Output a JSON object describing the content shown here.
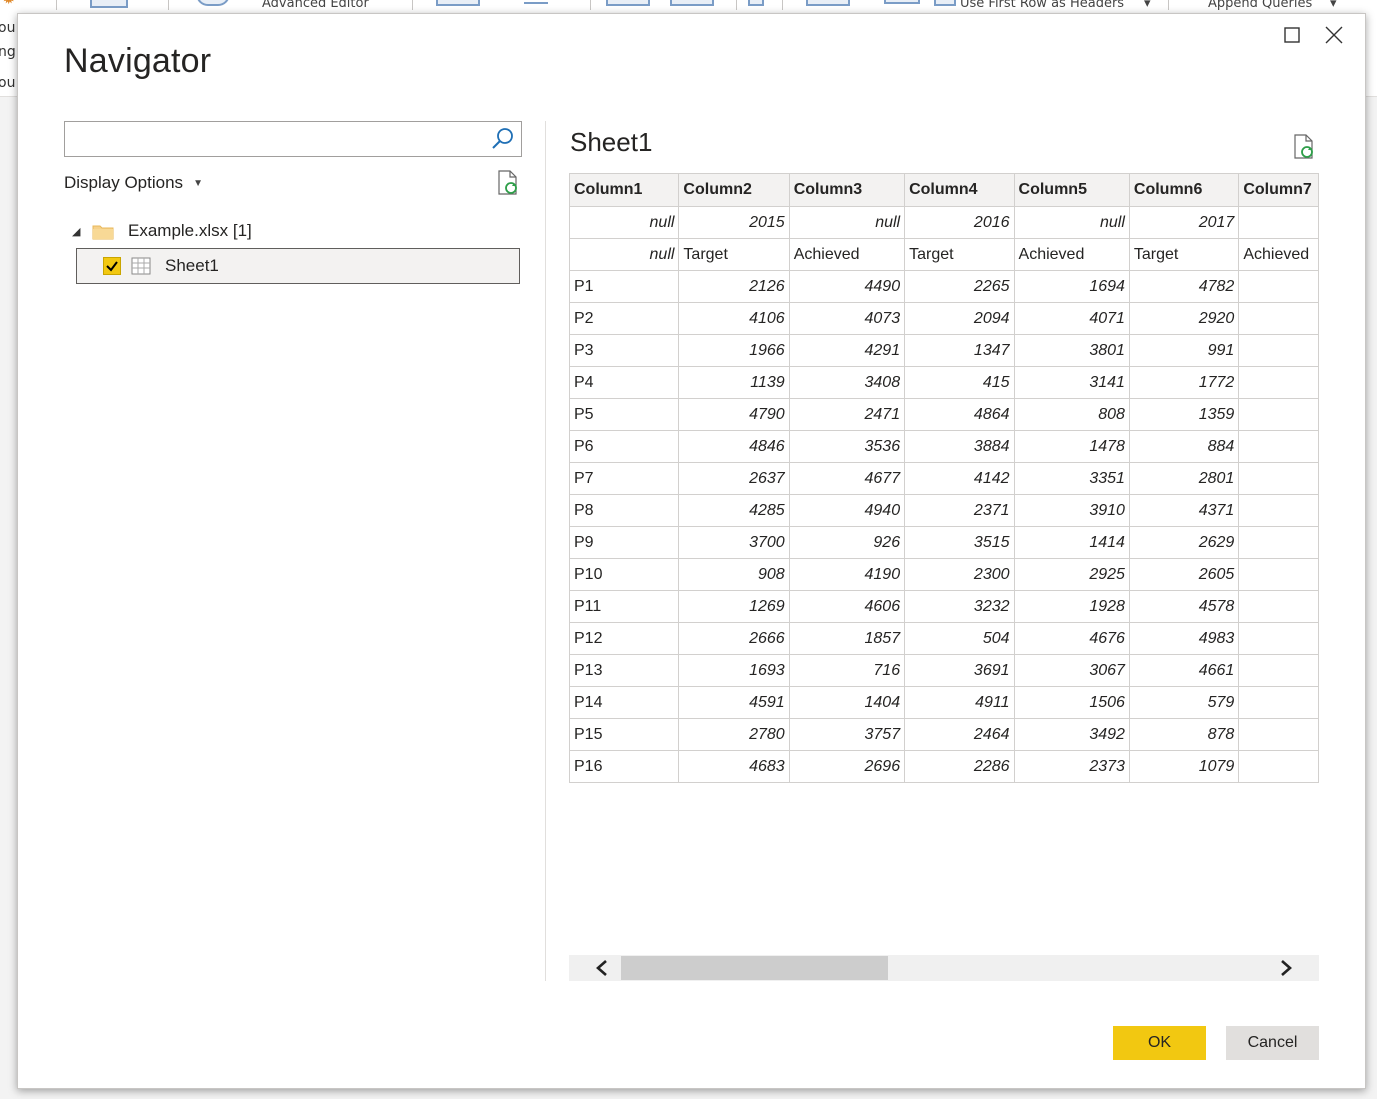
{
  "ribbon": {
    "advanced_editor": "Advanced Editor",
    "use_first_row": "Use First Row as Headers",
    "append_queries": "Append Queries",
    "left_fragments": [
      "ou",
      "ng",
      "ou"
    ]
  },
  "dialog": {
    "title": "Navigator",
    "search": {
      "value": "",
      "placeholder": ""
    },
    "display_options": "Display Options",
    "tree": {
      "file_label": "Example.xlsx [1]",
      "sheet_label": "Sheet1",
      "sheet_checked": true
    },
    "preview": {
      "title": "Sheet1",
      "columns": [
        "Column1",
        "Column2",
        "Column3",
        "Column4",
        "Column5",
        "Column6",
        "Column7"
      ],
      "rows": [
        [
          "",
          "null",
          "2015",
          "null",
          "2016",
          "null",
          "2017",
          ""
        ],
        [
          "",
          "null",
          "Target",
          "Achieved",
          "Target",
          "Achieved",
          "Target",
          "Achieved"
        ],
        [
          "P1",
          "2126",
          "4490",
          "2265",
          "1694",
          "4782",
          ""
        ],
        [
          "P2",
          "4106",
          "4073",
          "2094",
          "4071",
          "2920",
          ""
        ],
        [
          "P3",
          "1966",
          "4291",
          "1347",
          "3801",
          "991",
          ""
        ],
        [
          "P4",
          "1139",
          "3408",
          "415",
          "3141",
          "1772",
          ""
        ],
        [
          "P5",
          "4790",
          "2471",
          "4864",
          "808",
          "1359",
          ""
        ],
        [
          "P6",
          "4846",
          "3536",
          "3884",
          "1478",
          "884",
          ""
        ],
        [
          "P7",
          "2637",
          "4677",
          "4142",
          "3351",
          "2801",
          ""
        ],
        [
          "P8",
          "4285",
          "4940",
          "2371",
          "3910",
          "4371",
          ""
        ],
        [
          "P9",
          "3700",
          "926",
          "3515",
          "1414",
          "2629",
          ""
        ],
        [
          "P10",
          "908",
          "4190",
          "2300",
          "2925",
          "2605",
          ""
        ],
        [
          "P11",
          "1269",
          "4606",
          "3232",
          "1928",
          "4578",
          ""
        ],
        [
          "P12",
          "2666",
          "1857",
          "504",
          "4676",
          "4983",
          ""
        ],
        [
          "P13",
          "1693",
          "716",
          "3691",
          "3067",
          "4661",
          ""
        ],
        [
          "P14",
          "4591",
          "1404",
          "4911",
          "1506",
          "579",
          ""
        ],
        [
          "P15",
          "2780",
          "3757",
          "2464",
          "3492",
          "878",
          ""
        ],
        [
          "P16",
          "4683",
          "2696",
          "2286",
          "2373",
          "1079",
          ""
        ]
      ]
    },
    "buttons": {
      "ok": "OK",
      "cancel": "Cancel"
    }
  },
  "colors": {
    "accent": "#f2c811",
    "grid_border": "#d2d0ce",
    "header_bg": "#f3f2f1"
  },
  "icons": [
    "search-icon",
    "refresh-icon",
    "folder-icon",
    "table-icon",
    "checkbox-checked-icon",
    "maximize-icon",
    "close-icon",
    "chevron-left-icon",
    "chevron-right-icon",
    "caret-down-icon",
    "expander-icon"
  ]
}
